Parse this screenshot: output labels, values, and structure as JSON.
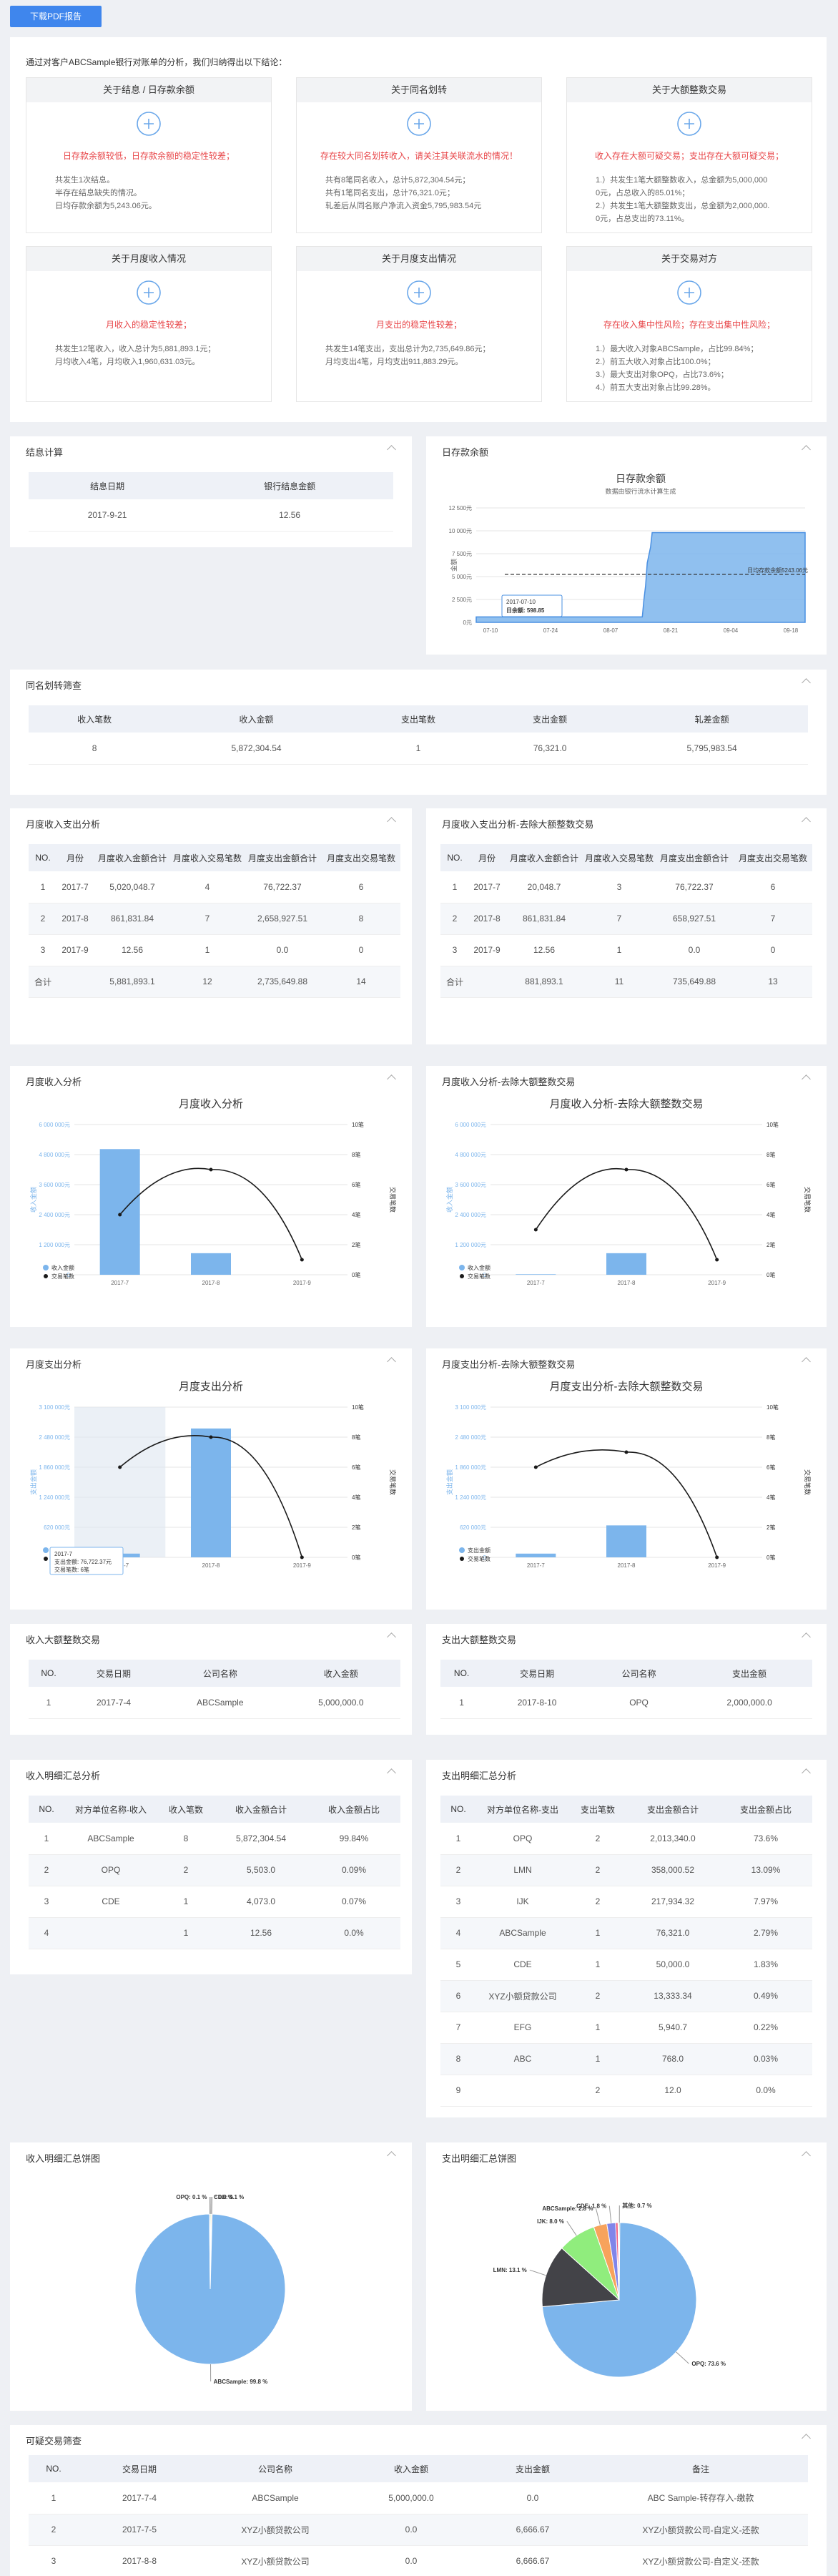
{
  "download_btn": "下载PDF报告",
  "summary": {
    "intro": "通过对客户ABCSample银行对账单的分析，我们归纳得出以下结论：",
    "boxes": [
      {
        "title": "关于结息 / 日存款余额",
        "red": "日存款余额较低，日存款余额的稳定性较差；",
        "lines": [
          "共发生1次结息。",
          "半存在结息缺失的情况。",
          "日均存款余额为5,243.06元。"
        ]
      },
      {
        "title": "关于同名划转",
        "red": "存在较大同名划转收入，请关注其关联流水的情况！",
        "lines": [
          "共有8笔同名收入，总计5,872,304.54元；",
          "共有1笔同名支出，总计76,321.0元；",
          "轧差后从同名账户净流入资金5,795,983.54元"
        ]
      },
      {
        "title": "关于大额整数交易",
        "red": "收入存在大额可疑交易；支出存在大额可疑交易；",
        "lines": [
          "1.）共发生1笔大额整数收入，总金额为5,000,000",
          "0元，占总收入的85.01%；",
          "2.）共发生1笔大额整数支出，总金额为2,000,000.",
          "0元，占总支出的73.11%。"
        ]
      },
      {
        "title": "关于月度收入情况",
        "red": "月收入的稳定性较差；",
        "lines": [
          "共发生12笔收入，收入总计为5,881,893.1元；",
          "月均收入4笔，月均收入1,960,631.03元。"
        ]
      },
      {
        "title": "关于月度支出情况",
        "red": "月支出的稳定性较差；",
        "lines": [
          "共发生14笔支出，支出总计为2,735,649.86元；",
          "月均支出4笔，月均支出911,883.29元。"
        ]
      },
      {
        "title": "关于交易对方",
        "red": "存在收入集中性风险；存在支出集中性风险；",
        "lines": [
          "1.）最大收入对象ABCSample，占比99.84%；",
          "2.）前五大收入对象占比100.0%；",
          "3.）最大支出对象OPQ，占比73.6%；",
          "4.）前五大支出对象占比99.28%。"
        ]
      }
    ]
  },
  "interest": {
    "title": "结息计算",
    "headers": [
      "结息日期",
      "银行结息金额"
    ],
    "rows": [
      [
        "2017-9-21",
        "12.56"
      ]
    ]
  },
  "daily_balance": {
    "card_title": "日存款余额",
    "chart_data": {
      "type": "area",
      "title": "日存款余额",
      "subtitle": "数据由银行流水计算生成",
      "ylabel": "金额",
      "x_ticks": [
        "07-10",
        "07-24",
        "08-07",
        "08-21",
        "09-04",
        "09-18"
      ],
      "y_ticks": [
        "0元",
        "2 500元",
        "5 000元",
        "7 500元",
        "10 000元",
        "12 500元"
      ],
      "ylim": [
        0,
        12500
      ],
      "mean_label": "日均存款余额5243.06元",
      "mean_value": 5243.06,
      "tooltip_date": "2017-07-10",
      "tooltip_text": "日余额: 598.85",
      "points": [
        [
          0,
          598.85
        ],
        [
          0.05,
          598.85
        ],
        [
          0.3,
          598.85
        ],
        [
          0.38,
          598.85
        ],
        [
          0.4,
          598.85
        ],
        [
          0.505,
          598.85
        ],
        [
          0.51,
          2500
        ],
        [
          0.515,
          4000
        ],
        [
          0.52,
          6500
        ],
        [
          0.53,
          8200
        ],
        [
          0.535,
          9800
        ],
        [
          1,
          9800
        ]
      ]
    }
  },
  "same_name": {
    "title": "同名划转筛查",
    "headers": [
      "收入笔数",
      "收入金额",
      "支出笔数",
      "支出金额",
      "轧差金额"
    ],
    "rows": [
      [
        "8",
        "5,872,304.54",
        "1",
        "76,321.0",
        "5,795,983.54"
      ]
    ]
  },
  "monthly": {
    "title": "月度收入支出分析",
    "headers": [
      "NO.",
      "月份",
      "月度收入金额合计",
      "月度收入交易笔数",
      "月度支出金额合计",
      "月度支出交易笔数"
    ],
    "rows": [
      [
        "1",
        "2017-7",
        "5,020,048.7",
        "4",
        "76,722.37",
        "6"
      ],
      [
        "2",
        "2017-8",
        "861,831.84",
        "7",
        "2,658,927.51",
        "8"
      ],
      [
        "3",
        "2017-9",
        "12.56",
        "1",
        "0.0",
        "0"
      ],
      [
        "合计",
        "",
        "5,881,893.1",
        "12",
        "2,735,649.88",
        "14"
      ]
    ]
  },
  "monthly_excl": {
    "title": "月度收入支出分析-去除大额整数交易",
    "headers": [
      "NO.",
      "月份",
      "月度收入金额合计",
      "月度收入交易笔数",
      "月度支出金额合计",
      "月度支出交易笔数"
    ],
    "rows": [
      [
        "1",
        "2017-7",
        "20,048.7",
        "3",
        "76,722.37",
        "6"
      ],
      [
        "2",
        "2017-8",
        "861,831.84",
        "7",
        "658,927.51",
        "7"
      ],
      [
        "3",
        "2017-9",
        "12.56",
        "1",
        "0.0",
        "0"
      ],
      [
        "合计",
        "",
        "881,893.1",
        "11",
        "735,649.88",
        "13"
      ]
    ]
  },
  "income_chart": {
    "card_title": "月度收入分析",
    "chart_data": {
      "type": "bar",
      "title": "月度收入分析",
      "categories": [
        "2017-7",
        "2017-8",
        "2017-9"
      ],
      "ylabel": "收入金额",
      "y2label": "交易笔数",
      "ylim": [
        0,
        6000000
      ],
      "y2lim": [
        0,
        10
      ],
      "y_ticks": [
        "0",
        "1 200 000元",
        "2 400 000元",
        "3 600 000元",
        "4 800 000元",
        "6 000 000元"
      ],
      "y2_ticks": [
        "0笔",
        "2笔",
        "4笔",
        "6笔",
        "8笔",
        "10笔"
      ],
      "series": [
        {
          "name": "收入金额",
          "values": [
            5020048.7,
            861831.84,
            12.56
          ]
        },
        {
          "name": "交易笔数",
          "values": [
            4,
            7,
            1
          ]
        }
      ]
    }
  },
  "income_chart_excl": {
    "card_title": "月度收入分析-去除大额整数交易",
    "chart_data": {
      "type": "bar",
      "title": "月度收入分析-去除大额整数交易",
      "categories": [
        "2017-7",
        "2017-8",
        "2017-9"
      ],
      "ylabel": "收入金额",
      "y2label": "交易笔数",
      "ylim": [
        0,
        6000000
      ],
      "y2lim": [
        0,
        10
      ],
      "y_ticks": [
        "0",
        "1 200 000元",
        "2 400 000元",
        "3 600 000元",
        "4 800 000元",
        "6 000 000元"
      ],
      "y2_ticks": [
        "0笔",
        "2笔",
        "4笔",
        "6笔",
        "8笔",
        "10笔"
      ],
      "series": [
        {
          "name": "收入金额",
          "values": [
            20048.7,
            861831.84,
            12.56
          ]
        },
        {
          "name": "交易笔数",
          "values": [
            3,
            7,
            1
          ]
        }
      ]
    }
  },
  "expense_chart": {
    "card_title": "月度支出分析",
    "chart_data": {
      "type": "bar",
      "title": "月度支出分析",
      "categories": [
        "2017-7",
        "2017-8",
        "2017-9"
      ],
      "ylabel": "支出金额",
      "y2label": "交易笔数",
      "ylim": [
        0,
        3100000
      ],
      "y2lim": [
        0,
        10
      ],
      "y_ticks": [
        "0",
        "620 000元",
        "1 240 000元",
        "1 860 000元",
        "2 480 000元",
        "3 100 000元"
      ],
      "y2_ticks": [
        "0笔",
        "2笔",
        "4笔",
        "6笔",
        "8笔",
        "10笔"
      ],
      "series": [
        {
          "name": "支出金额",
          "values": [
            76722.37,
            2658927.51,
            0
          ]
        },
        {
          "name": "交易笔数",
          "values": [
            6,
            8,
            0
          ]
        }
      ],
      "tooltip": [
        "2017-7",
        "支出金额: 76,722.37元",
        "交易笔数: 6笔"
      ]
    }
  },
  "expense_chart_excl": {
    "card_title": "月度支出分析-去除大额整数交易",
    "chart_data": {
      "type": "bar",
      "title": "月度支出分析-去除大额整数交易",
      "categories": [
        "2017-7",
        "2017-8",
        "2017-9"
      ],
      "ylabel": "支出金额",
      "y2label": "交易笔数",
      "ylim": [
        0,
        3100000
      ],
      "y2lim": [
        0,
        10
      ],
      "y_ticks": [
        "0",
        "620 000元",
        "1 240 000元",
        "1 860 000元",
        "2 480 000元",
        "3 100 000元"
      ],
      "y2_ticks": [
        "0笔",
        "2笔",
        "4笔",
        "6笔",
        "8笔",
        "10笔"
      ],
      "series": [
        {
          "name": "支出金额",
          "values": [
            76722.37,
            658927.51,
            0
          ]
        },
        {
          "name": "交易笔数",
          "values": [
            6,
            7,
            0
          ]
        }
      ]
    }
  },
  "big_income": {
    "title": "收入大额整数交易",
    "headers": [
      "NO.",
      "交易日期",
      "公司名称",
      "收入金额"
    ],
    "rows": [
      [
        "1",
        "2017-7-4",
        "ABCSample",
        "5,000,000.0"
      ]
    ]
  },
  "big_expense": {
    "title": "支出大额整数交易",
    "headers": [
      "NO.",
      "交易日期",
      "公司名称",
      "支出金额"
    ],
    "rows": [
      [
        "1",
        "2017-8-10",
        "OPQ",
        "2,000,000.0"
      ]
    ]
  },
  "income_detail": {
    "title": "收入明细汇总分析",
    "headers": [
      "NO.",
      "对方单位名称-收入",
      "收入笔数",
      "收入金额合计",
      "收入金额占比"
    ],
    "rows": [
      [
        "1",
        "ABCSample",
        "8",
        "5,872,304.54",
        "99.84%"
      ],
      [
        "2",
        "OPQ",
        "2",
        "5,503.0",
        "0.09%"
      ],
      [
        "3",
        "CDE",
        "1",
        "4,073.0",
        "0.07%"
      ],
      [
        "4",
        "",
        "1",
        "12.56",
        "0.0%"
      ]
    ]
  },
  "expense_detail": {
    "title": "支出明细汇总分析",
    "headers": [
      "NO.",
      "对方单位名称-支出",
      "支出笔数",
      "支出金额合计",
      "支出金额占比"
    ],
    "rows": [
      [
        "1",
        "OPQ",
        "2",
        "2,013,340.0",
        "73.6%"
      ],
      [
        "2",
        "LMN",
        "2",
        "358,000.52",
        "13.09%"
      ],
      [
        "3",
        "IJK",
        "2",
        "217,934.32",
        "7.97%"
      ],
      [
        "4",
        "ABCSample",
        "1",
        "76,321.0",
        "2.79%"
      ],
      [
        "5",
        "CDE",
        "1",
        "50,000.0",
        "1.83%"
      ],
      [
        "6",
        "XYZ小额贷款公司",
        "2",
        "13,333.34",
        "0.49%"
      ],
      [
        "7",
        "EFG",
        "1",
        "5,940.7",
        "0.22%"
      ],
      [
        "8",
        "ABC",
        "1",
        "768.0",
        "0.03%"
      ],
      [
        "9",
        "",
        "2",
        "12.0",
        "0.0%"
      ]
    ]
  },
  "income_pie": {
    "card_title": "收入明细汇总饼图",
    "chart_data": {
      "type": "pie",
      "slices": [
        {
          "name": "ABCSample",
          "label": "ABCSample: 99.8 %",
          "value": 99.84,
          "color": "#7cb5ec"
        },
        {
          "name": "OPQ",
          "label": "OPQ: 0.1 %",
          "value": 0.09,
          "color": "#434348"
        },
        {
          "name": "CDE",
          "label": "CDE: 0.1 %",
          "value": 0.07,
          "color": "#90ed7d"
        },
        {
          "name": "",
          "label": ": 0.0 %",
          "value": 0.0,
          "color": "#f7a35c"
        }
      ]
    }
  },
  "expense_pie": {
    "card_title": "支出明细汇总饼图",
    "chart_data": {
      "type": "pie",
      "slices": [
        {
          "name": "OPQ",
          "label": "OPQ: 73.6 %",
          "value": 73.6,
          "color": "#7cb5ec"
        },
        {
          "name": "LMN",
          "label": "LMN: 13.1 %",
          "value": 13.09,
          "color": "#434348"
        },
        {
          "name": "IJK",
          "label": "IJK: 8.0 %",
          "value": 7.97,
          "color": "#90ed7d"
        },
        {
          "name": "ABCSample",
          "label": "ABCSample: 2.8 %",
          "value": 2.79,
          "color": "#f7a35c"
        },
        {
          "name": "CDE",
          "label": "CDE: 1.8 %",
          "value": 1.83,
          "color": "#8085e9"
        },
        {
          "name": "XYZ",
          "label": "",
          "value": 0.49,
          "color": "#f15c80"
        },
        {
          "name": "EFG",
          "label": "",
          "value": 0.22,
          "color": "#e4d354"
        },
        {
          "name": "ABC",
          "label": "其他: 0.7 %",
          "value": 0.03,
          "color": "#2b908f"
        }
      ]
    }
  },
  "suspicious": {
    "title": "可疑交易筛查",
    "headers": [
      "NO.",
      "交易日期",
      "公司名称",
      "收入金额",
      "支出金额",
      "备注"
    ],
    "rows": [
      [
        "1",
        "2017-7-4",
        "ABCSample",
        "5,000,000.0",
        "0.0",
        "ABC Sample-转存存入-缴款"
      ],
      [
        "2",
        "2017-7-5",
        "XYZ小额贷款公司",
        "0.0",
        "6,666.67",
        "XYZ小额贷款公司-自定义-还款"
      ],
      [
        "3",
        "2017-8-8",
        "XYZ小额贷款公司",
        "0.0",
        "6,666.67",
        "XYZ小额贷款公司-自定义-还款"
      ]
    ]
  }
}
